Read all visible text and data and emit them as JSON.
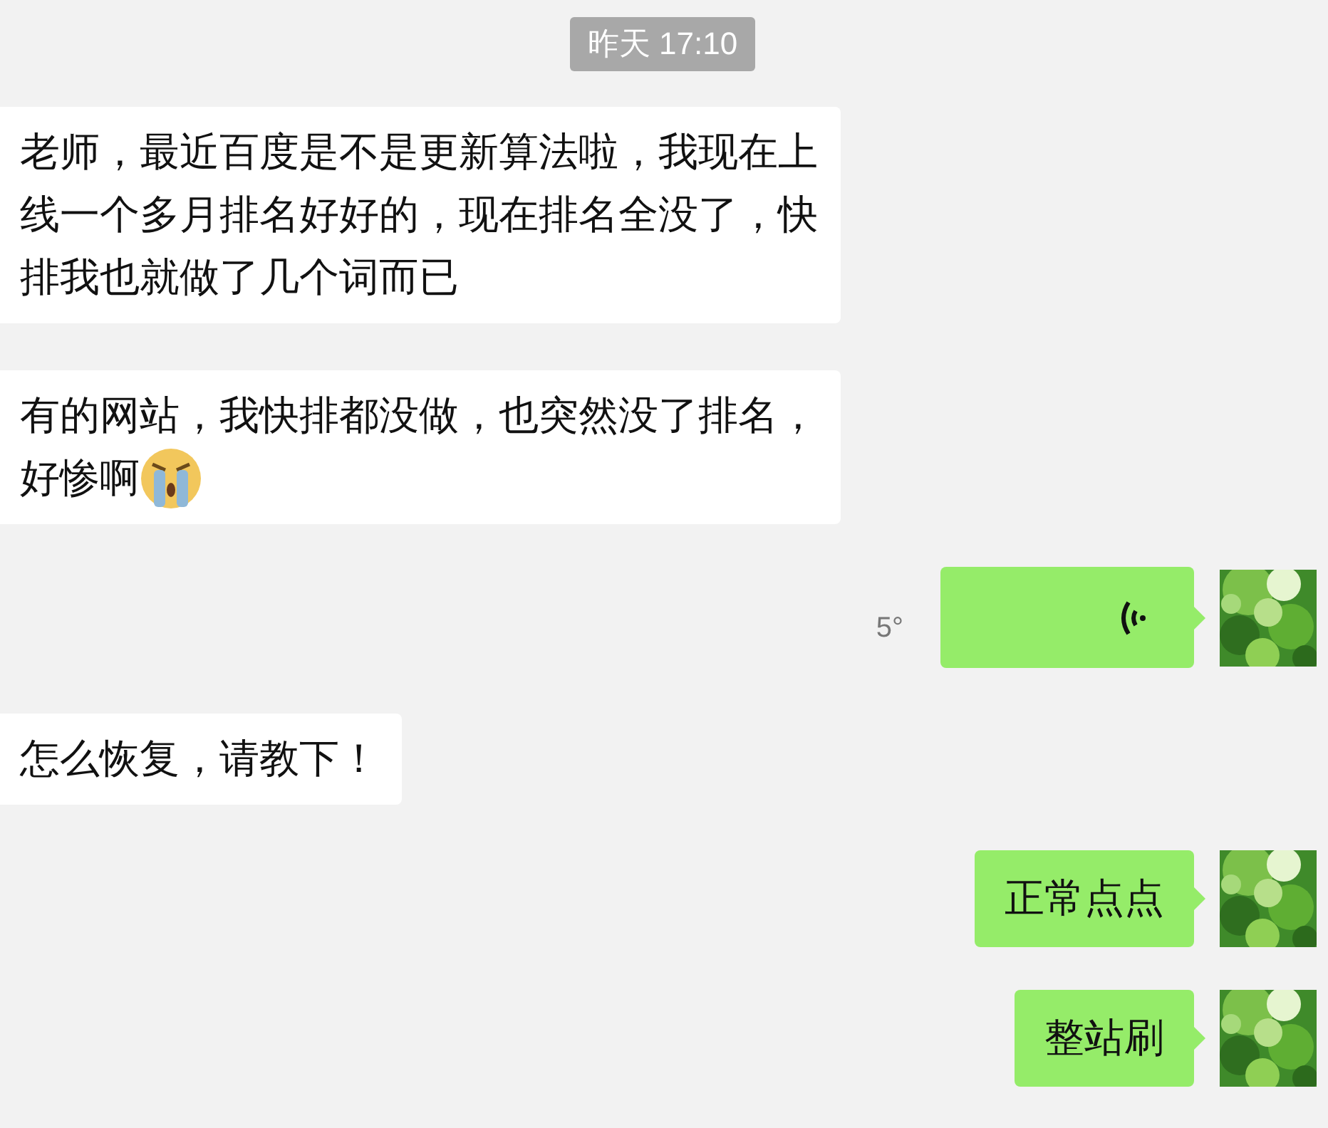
{
  "timestamp": "昨天 17:10",
  "messages": [
    {
      "outgoing": false,
      "kind": "text",
      "lines": [
        "老师，最近百度是不是更新算法啦，我现在上",
        "线一个多月排名好好的，现在排名全没了，快",
        "排我也就做了几个词而已"
      ],
      "emoji": false
    },
    {
      "outgoing": false,
      "kind": "text",
      "lines": [
        "有的网站，我快排都没做，也突然没了排名，",
        "好惨啊"
      ],
      "emoji": true
    },
    {
      "outgoing": true,
      "kind": "voice",
      "duration": "5°",
      "avatar": {
        "kind": "picture"
      }
    },
    {
      "outgoing": false,
      "kind": "text",
      "lines": [
        "怎么恢复，请教下！"
      ],
      "emoji": false
    },
    {
      "outgoing": true,
      "kind": "text",
      "lines": [
        "正常点点"
      ],
      "emoji": false,
      "avatar": {
        "kind": "picture"
      }
    },
    {
      "outgoing": true,
      "kind": "text",
      "lines": [
        "整站刷"
      ],
      "emoji": false,
      "avatar": {
        "kind": "picture"
      }
    }
  ]
}
